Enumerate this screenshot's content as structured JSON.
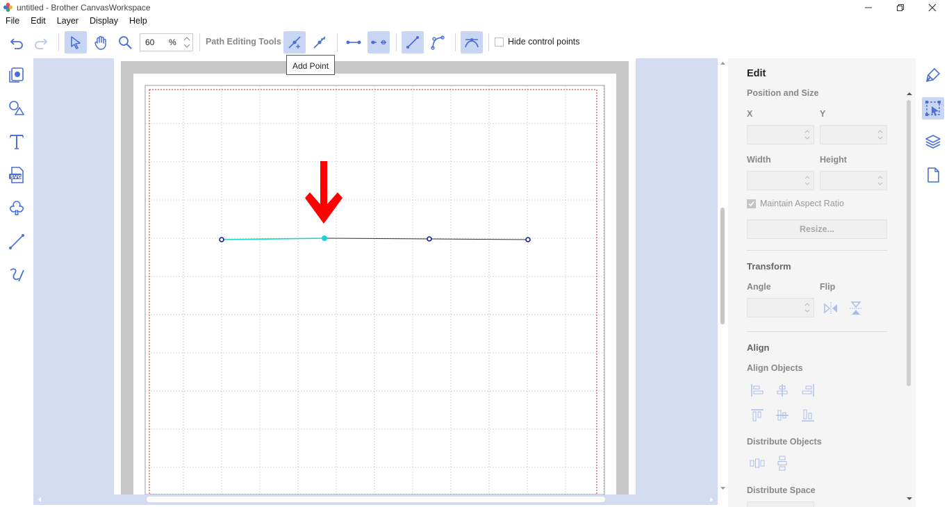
{
  "window": {
    "title": "untitled - Brother CanvasWorkspace",
    "minimize_label": "Minimize",
    "restore_label": "Restore",
    "close_label": "Close"
  },
  "menu": [
    "File",
    "Edit",
    "Layer",
    "Display",
    "Help"
  ],
  "toolbar": {
    "zoom_value": "60",
    "zoom_unit": "%",
    "path_editing_label": "Path Editing Tools",
    "hide_control_points_label": "Hide control points",
    "hide_control_points_checked": false,
    "tooltip": "Add Point",
    "tools": [
      "undo-icon",
      "redo-icon",
      "select-icon",
      "hand-icon",
      "zoom-icon",
      "add-point-icon",
      "delete-point-icon",
      "join-points-icon",
      "split-point-icon",
      "straight-line-icon",
      "curve-icon",
      "smooth-point-icon"
    ]
  },
  "left_tools": [
    "pattern-icon",
    "shapes-icon",
    "text-icon",
    "svg-import-icon",
    "image-trace-icon",
    "line-icon",
    "freehand-icon"
  ],
  "canvas": {
    "path_points": 4,
    "selected_point_index": 1,
    "annotation": "red-down-arrow",
    "selected_color": "#19d2d2",
    "point_color": "#1717a8",
    "cut_margin_color": "#d02020"
  },
  "panel": {
    "title": "Edit",
    "position_size": {
      "heading": "Position and Size",
      "x_label": "X",
      "y_label": "Y",
      "x_value": "",
      "y_value": "",
      "width_label": "Width",
      "height_label": "Height",
      "width_value": "",
      "height_value": "",
      "aspect_label": "Maintain Aspect Ratio",
      "aspect_checked": true,
      "resize_label": "Resize..."
    },
    "transform": {
      "heading": "Transform",
      "angle_label": "Angle",
      "angle_value": "",
      "flip_label": "Flip"
    },
    "align": {
      "heading": "Align",
      "align_objects_label": "Align Objects",
      "distribute_objects_label": "Distribute Objects",
      "distribute_space_label": "Distribute Space"
    }
  },
  "right_strip": [
    "paint-icon",
    "edit-select-icon",
    "layers-icon",
    "page-icon"
  ],
  "colors": {
    "accent": "#4a6fd6",
    "active_bg": "#c9d6f3",
    "canvas_bg": "#d2dbef"
  }
}
